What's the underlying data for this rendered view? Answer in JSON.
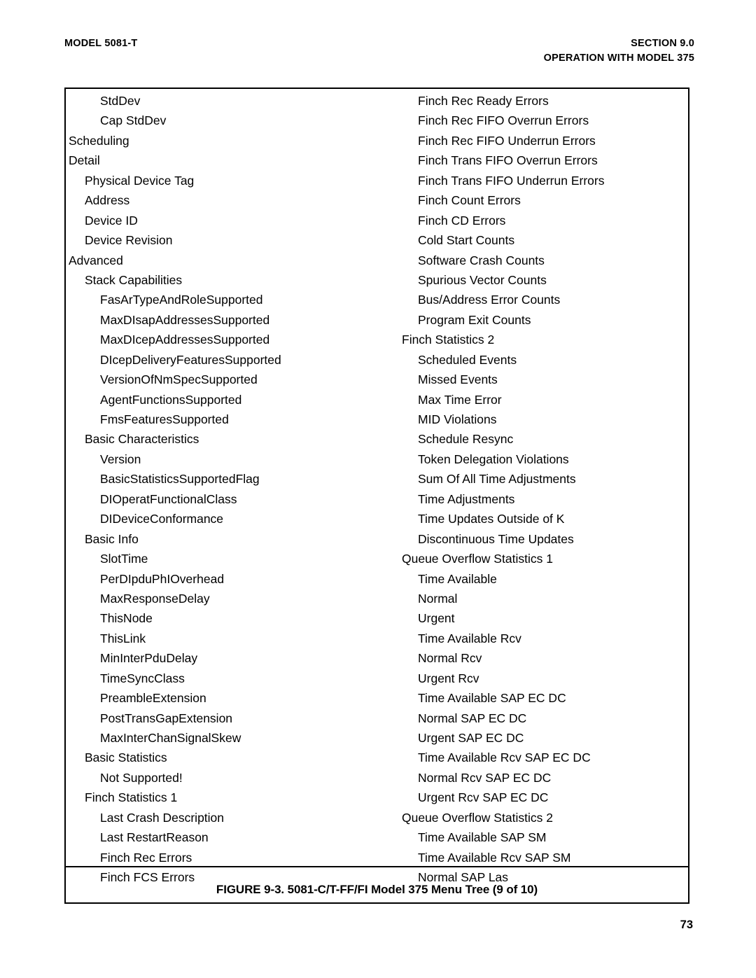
{
  "header": {
    "left": "MODEL 5081-T",
    "right_line1": "SECTION 9.0",
    "right_line2": "OPERATION WITH MODEL 375"
  },
  "figure": {
    "caption": "FIGURE 9-3. 5081-C/T-FF/FI Model 375 Menu Tree (9 of 10)"
  },
  "page_number": "73",
  "menu_tree": {
    "left_column": [
      {
        "label": "StdDev",
        "level": 2
      },
      {
        "label": "Cap StdDev",
        "level": 2
      },
      {
        "label": "Scheduling",
        "level": 0
      },
      {
        "label": "Detail",
        "level": 0
      },
      {
        "label": "Physical Device Tag",
        "level": 1
      },
      {
        "label": "Address",
        "level": 1
      },
      {
        "label": "Device ID",
        "level": 1
      },
      {
        "label": "Device Revision",
        "level": 1
      },
      {
        "label": "Advanced",
        "level": 0
      },
      {
        "label": "Stack Capabilities",
        "level": 1
      },
      {
        "label": "FasArTypeAndRoleSupported",
        "level": 2
      },
      {
        "label": "MaxDIsapAddressesSupported",
        "level": 2
      },
      {
        "label": "MaxDIcepAddressesSupported",
        "level": 2
      },
      {
        "label": "DIcepDeliveryFeaturesSupported",
        "level": 2
      },
      {
        "label": "VersionOfNmSpecSupported",
        "level": 2
      },
      {
        "label": "AgentFunctionsSupported",
        "level": 2
      },
      {
        "label": "FmsFeaturesSupported",
        "level": 2
      },
      {
        "label": "Basic Characteristics",
        "level": 1
      },
      {
        "label": "Version",
        "level": 2
      },
      {
        "label": "BasicStatisticsSupportedFlag",
        "level": 2
      },
      {
        "label": "DIOperatFunctionalClass",
        "level": 2
      },
      {
        "label": "DIDeviceConformance",
        "level": 2
      },
      {
        "label": "Basic Info",
        "level": 1
      },
      {
        "label": "SlotTime",
        "level": 2
      },
      {
        "label": "PerDIpduPhIOverhead",
        "level": 2
      },
      {
        "label": "MaxResponseDelay",
        "level": 2
      },
      {
        "label": "ThisNode",
        "level": 2
      },
      {
        "label": "ThisLink",
        "level": 2
      },
      {
        "label": "MinInterPduDelay",
        "level": 2
      },
      {
        "label": "TimeSyncClass",
        "level": 2
      },
      {
        "label": "PreambleExtension",
        "level": 2
      },
      {
        "label": "PostTransGapExtension",
        "level": 2
      },
      {
        "label": "MaxInterChanSignalSkew",
        "level": 2
      },
      {
        "label": "Basic Statistics",
        "level": 1
      },
      {
        "label": "Not Supported!",
        "level": 2
      },
      {
        "label": "Finch Statistics 1",
        "level": 1
      },
      {
        "label": "Last Crash Description",
        "level": 2
      },
      {
        "label": "Last RestartReason",
        "level": 2
      },
      {
        "label": "Finch Rec Errors",
        "level": 2
      },
      {
        "label": "Finch FCS Errors",
        "level": 2
      }
    ],
    "right_column": [
      {
        "label": "Finch Rec Ready Errors",
        "level": 1
      },
      {
        "label": "Finch Rec FIFO Overrun Errors",
        "level": 1
      },
      {
        "label": "Finch Rec FIFO Underrun Errors",
        "level": 1
      },
      {
        "label": "Finch Trans FIFO Overrun Errors",
        "level": 1
      },
      {
        "label": "Finch Trans FIFO Underrun Errors",
        "level": 1
      },
      {
        "label": "Finch Count Errors",
        "level": 1
      },
      {
        "label": "Finch CD Errors",
        "level": 1
      },
      {
        "label": "Cold Start Counts",
        "level": 1
      },
      {
        "label": "Software Crash Counts",
        "level": 1
      },
      {
        "label": "Spurious Vector Counts",
        "level": 1
      },
      {
        "label": "Bus/Address Error Counts",
        "level": 1
      },
      {
        "label": "Program Exit Counts",
        "level": 1
      },
      {
        "label": "Finch Statistics 2",
        "level": 0
      },
      {
        "label": "Scheduled Events",
        "level": 1
      },
      {
        "label": "Missed Events",
        "level": 1
      },
      {
        "label": "Max Time Error",
        "level": 1
      },
      {
        "label": "MID Violations",
        "level": 1
      },
      {
        "label": "Schedule Resync",
        "level": 1
      },
      {
        "label": "Token Delegation Violations",
        "level": 1
      },
      {
        "label": "Sum Of All Time Adjustments",
        "level": 1
      },
      {
        "label": "Time Adjustments",
        "level": 1
      },
      {
        "label": "Time Updates Outside of K",
        "level": 1
      },
      {
        "label": "Discontinuous Time Updates",
        "level": 1
      },
      {
        "label": "Queue Overflow Statistics 1",
        "level": 0
      },
      {
        "label": "Time Available",
        "level": 1
      },
      {
        "label": "Normal",
        "level": 1
      },
      {
        "label": "Urgent",
        "level": 1
      },
      {
        "label": "Time Available Rcv",
        "level": 1
      },
      {
        "label": "Normal Rcv",
        "level": 1
      },
      {
        "label": "Urgent Rcv",
        "level": 1
      },
      {
        "label": "Time Available SAP EC DC",
        "level": 1
      },
      {
        "label": "Normal SAP EC DC",
        "level": 1
      },
      {
        "label": "Urgent SAP EC DC",
        "level": 1
      },
      {
        "label": "Time Available Rcv SAP EC DC",
        "level": 1
      },
      {
        "label": "Normal Rcv SAP EC DC",
        "level": 1
      },
      {
        "label": "Urgent Rcv SAP EC DC",
        "level": 1
      },
      {
        "label": "Queue Overflow Statistics 2",
        "level": 0
      },
      {
        "label": "Time Available SAP SM",
        "level": 1
      },
      {
        "label": "Time Available Rcv SAP SM",
        "level": 1
      },
      {
        "label": "Normal SAP Las",
        "level": 1
      }
    ]
  }
}
